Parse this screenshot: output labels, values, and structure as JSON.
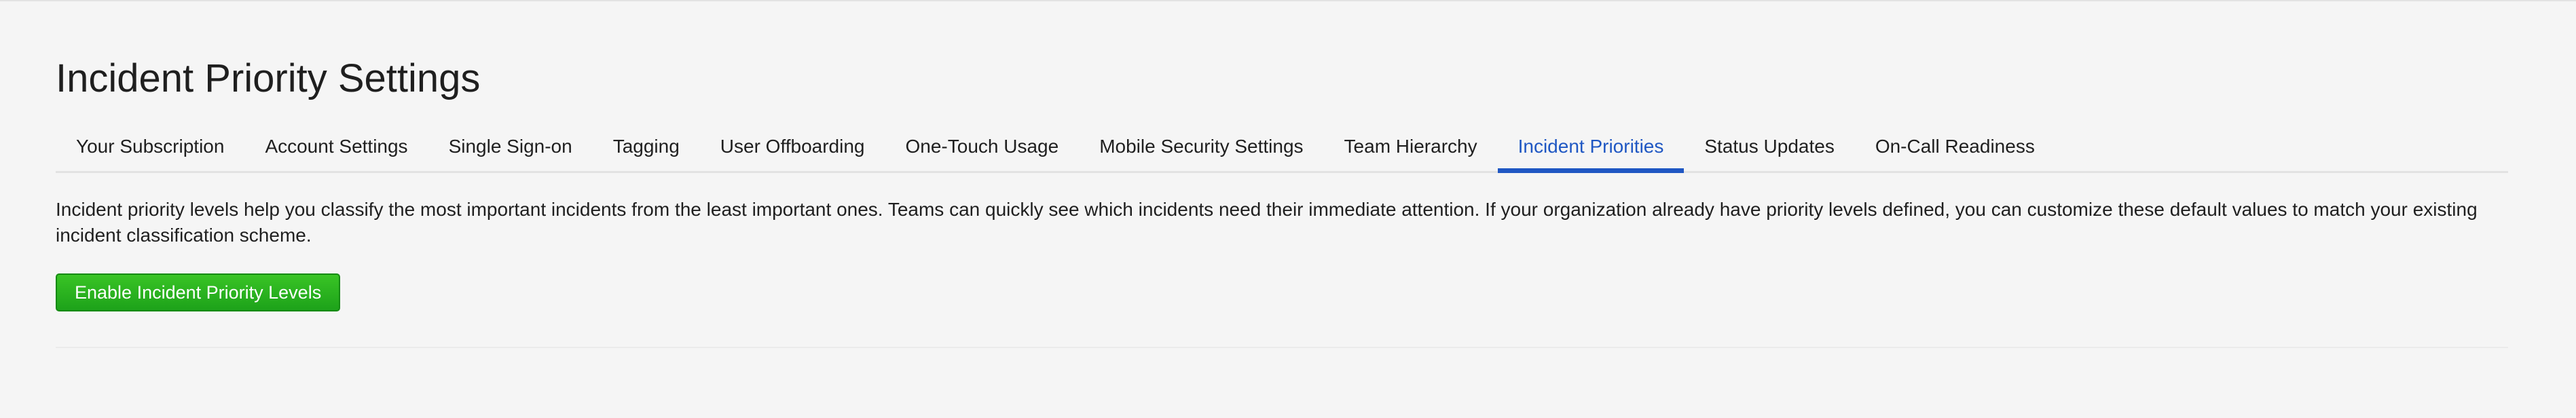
{
  "page": {
    "title": "Incident Priority Settings"
  },
  "tabs": [
    {
      "label": "Your Subscription",
      "active": false
    },
    {
      "label": "Account Settings",
      "active": false
    },
    {
      "label": "Single Sign-on",
      "active": false
    },
    {
      "label": "Tagging",
      "active": false
    },
    {
      "label": "User Offboarding",
      "active": false
    },
    {
      "label": "One-Touch Usage",
      "active": false
    },
    {
      "label": "Mobile Security Settings",
      "active": false
    },
    {
      "label": "Team Hierarchy",
      "active": false
    },
    {
      "label": "Incident Priorities",
      "active": true
    },
    {
      "label": "Status Updates",
      "active": false
    },
    {
      "label": "On-Call Readiness",
      "active": false
    }
  ],
  "content": {
    "description": "Incident priority levels help you classify the most important incidents from the least important ones. Teams can quickly see which incidents need their immediate attention. If your organization already have priority levels defined, you can customize these default values to match your existing incident classification scheme.",
    "enable_button_label": "Enable Incident Priority Levels"
  },
  "colors": {
    "active_tab": "#1f57c3",
    "primary_button": "#1da21a",
    "background": "#f5f5f5"
  }
}
